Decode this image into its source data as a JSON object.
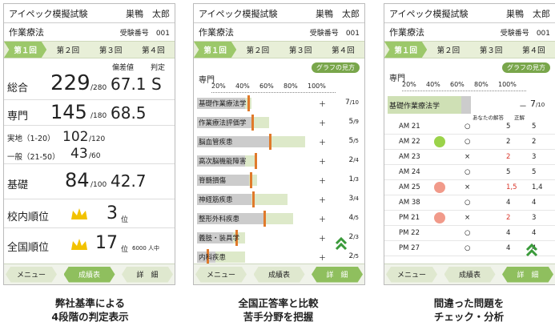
{
  "app": {
    "title": "アイペック模擬試験",
    "user": "巣鴨　太郎",
    "subject": "作業療法",
    "exam_label": "受験番号",
    "exam_no": "001"
  },
  "tabs": [
    "第１回",
    "第２回",
    "第３回",
    "第４回"
  ],
  "footer": {
    "menu": "メニュー",
    "results": "成績表",
    "detail": "詳　細"
  },
  "panel1": {
    "header_hensachi": "偏差値",
    "header_hantei": "判定",
    "total": {
      "label": "総合",
      "score": "229",
      "max": "/280",
      "dev": "67.1",
      "grade": "S"
    },
    "senmon": {
      "label": "専門",
      "score": "145",
      "max": "/180",
      "dev": "68.5"
    },
    "jitchi": {
      "label": "実地（1-20）",
      "score": "102",
      "max": "/120"
    },
    "ippan": {
      "label": "一般（21-50）",
      "score": "43",
      "max": "/60"
    },
    "kiso": {
      "label": "基礎",
      "score": "84",
      "max": "/100",
      "dev": "42.7"
    },
    "school_rank": {
      "label": "校内順位",
      "value": "3",
      "unit": "位"
    },
    "national_rank": {
      "label": "全国順位",
      "value": "17",
      "unit": "位",
      "total": "6000 人中"
    }
  },
  "panel2": {
    "button": "グラフの見方",
    "section": "専門",
    "axis": [
      "20%",
      "40%",
      "60%",
      "80%",
      "100%"
    ],
    "rows": [
      {
        "label": "基礎作業療法学",
        "gray": 0.4,
        "green": 0.45,
        "mark": 0.42,
        "plus": "＋",
        "score": "7",
        "max": "/10"
      },
      {
        "label": "作業療法評価学",
        "gray": 0.45,
        "green": 0.6,
        "mark": 0.45,
        "plus": "＋",
        "score": "5",
        "max": "/9"
      },
      {
        "label": "脳血管疾患",
        "gray": 0.62,
        "green": 0.9,
        "mark": 0.6,
        "plus": "＋",
        "score": "5",
        "max": "/5"
      },
      {
        "label": "高次脳機能障害",
        "gray": 0.4,
        "green": 0.5,
        "mark": 0.48,
        "plus": "＋",
        "score": "2",
        "max": "/4"
      },
      {
        "label": "脊髄損傷",
        "gray": 0.43,
        "green": 0.5,
        "mark": 0.44,
        "plus": "＋",
        "score": "1",
        "max": "/3"
      },
      {
        "label": "神経筋疾患",
        "gray": 0.45,
        "green": 0.75,
        "mark": 0.46,
        "plus": "＋",
        "score": "3",
        "max": "/4"
      },
      {
        "label": "整形外科疾患",
        "gray": 0.56,
        "green": 0.8,
        "mark": 0.55,
        "plus": "＋",
        "score": "4",
        "max": "/5"
      },
      {
        "label": "義肢・装具学",
        "gray": 0.3,
        "green": 0.4,
        "mark": 0.32,
        "plus": "＋",
        "score": "2",
        "max": "/3"
      },
      {
        "label": "内科疾患",
        "gray": 0.15,
        "green": 0.4,
        "mark": 0.08,
        "plus": "＋",
        "score": "2",
        "max": "/5"
      }
    ]
  },
  "panel3": {
    "button": "グラフの見方",
    "section": "専門",
    "axis": [
      "20%",
      "40%",
      "60%",
      "80%",
      "100%"
    ],
    "bar": {
      "label": "基礎作業療法学",
      "dash": "－",
      "score": "7",
      "max": "/10"
    },
    "col_answer": "あなたの解答",
    "col_correct": "正解",
    "rows": [
      {
        "q": "AM 21",
        "mark": "○",
        "ans": "5",
        "ok": "5",
        "wrong": false
      },
      {
        "q": "AM 22",
        "mark": "○",
        "ans": "2",
        "ok": "2",
        "wrong": false
      },
      {
        "q": "AM 23",
        "mark": "×",
        "ans": "2",
        "ok": "3",
        "wrong": true
      },
      {
        "q": "AM 24",
        "mark": "○",
        "ans": "5",
        "ok": "5",
        "wrong": false
      },
      {
        "q": "AM 25",
        "mark": "×",
        "ans": "1,5",
        "ok": "1,4",
        "wrong": true
      },
      {
        "q": "AM 38",
        "mark": "○",
        "ans": "4",
        "ok": "4",
        "wrong": false
      },
      {
        "q": "PM 21",
        "mark": "×",
        "ans": "2",
        "ok": "3",
        "wrong": true
      },
      {
        "q": "PM 22",
        "mark": "○",
        "ans": "4",
        "ok": "4",
        "wrong": false
      },
      {
        "q": "PM 27",
        "mark": "○",
        "ans": "4",
        "ok": "4",
        "wrong": false
      }
    ]
  },
  "captions": [
    [
      "弊社基準による",
      "4段階の判定表示"
    ],
    [
      "全国正答率と比較",
      "苦手分野を把握"
    ],
    [
      "間違った問題を",
      "チェック・分析"
    ]
  ]
}
